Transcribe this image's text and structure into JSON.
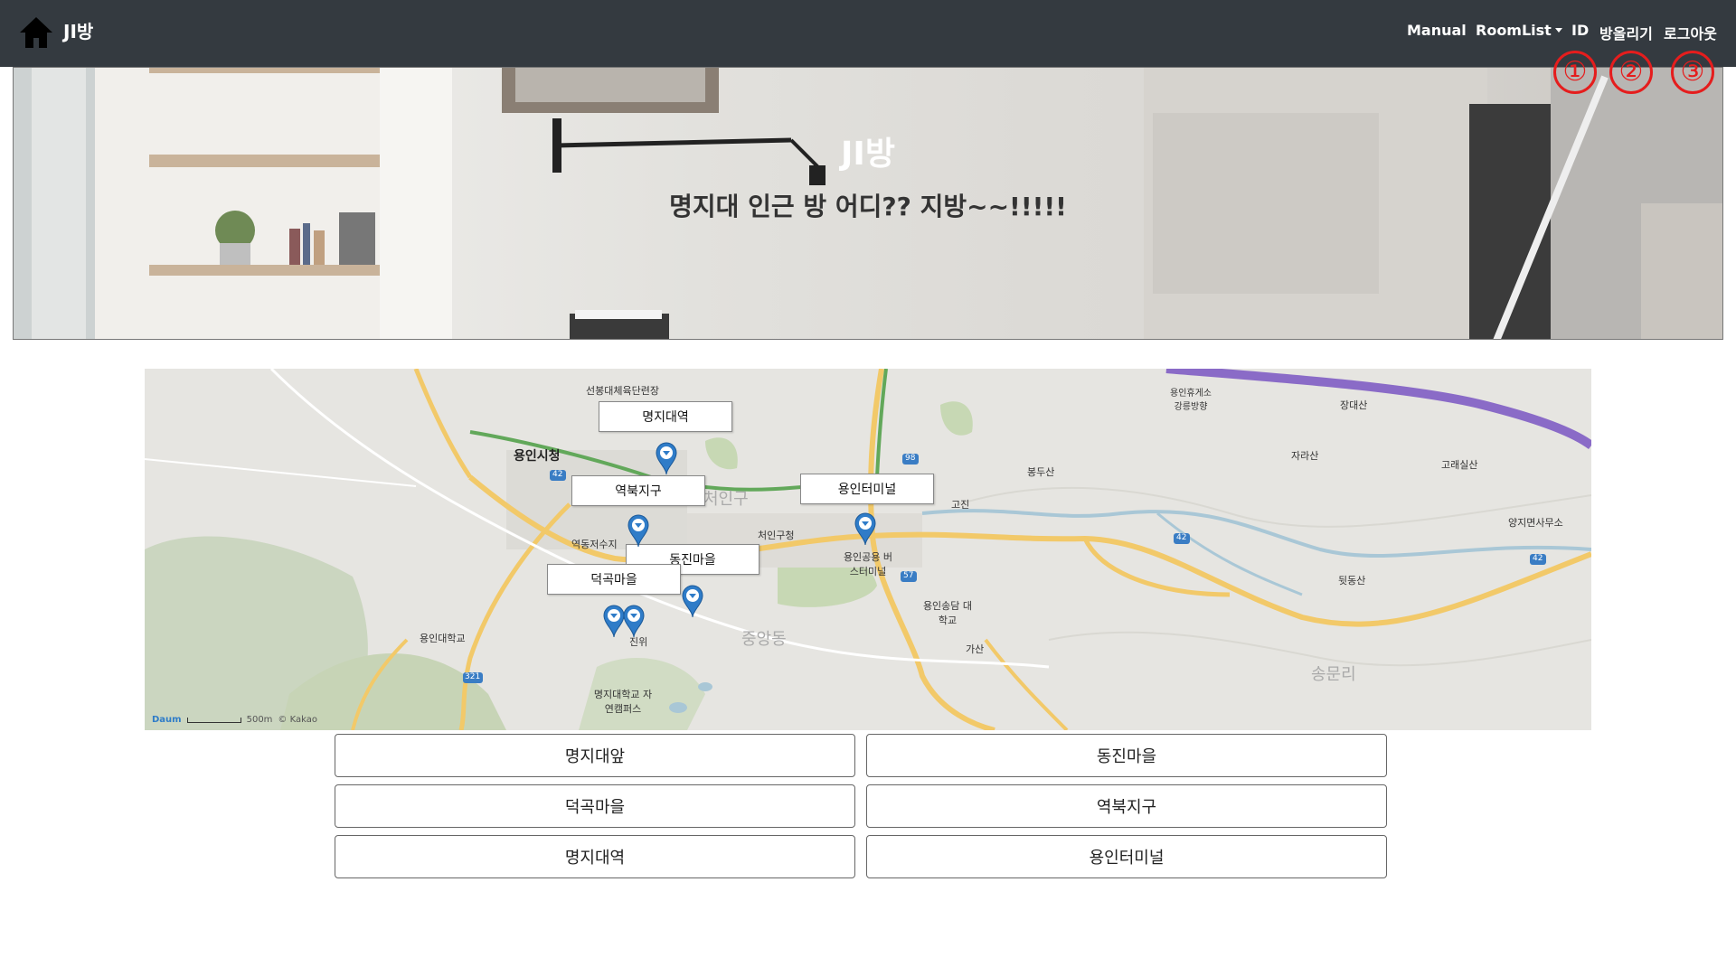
{
  "navbar": {
    "brand": "JI방",
    "home_icon": "home-icon",
    "items": {
      "manual": "Manual",
      "roomlist": "RoomList",
      "id": "ID",
      "upload": "방올리기",
      "logout": "로그아웃"
    },
    "annotations": [
      "①",
      "②",
      "③"
    ],
    "annotation_color": "#e51d1d",
    "bg_color": "#343a40"
  },
  "hero": {
    "title": "JI방",
    "subtitle": "명지대 인근 방 어디?? 지방~~!!!!!"
  },
  "map": {
    "markers": {
      "myeongji_station": "명지대역",
      "yeokbuk": "역북지구",
      "yongin_terminal": "용인터미널",
      "dongjin": "동진마을",
      "deokgok": "덕곡마을"
    },
    "place_names": {
      "sunbong_park": "선봉대체육단련장",
      "yongin_cityhall": "용인시청",
      "cheoin_gu": "처인구",
      "cheoin_office": "처인구청",
      "yeokbuk_lake": "역동저수지",
      "bus_terminal": "용인공용 버스터미널",
      "yongin_univ": "용인대학교",
      "songdam_college": "용인송담 대학교",
      "jangdaesan": "장대산",
      "jarasan": "자라산",
      "goraesilsan": "고래실산",
      "bongdusan": "봉두산",
      "twitdongsan": "뒷동산",
      "jungang_dong": "중앙동",
      "songmun_ri": "송문리",
      "myongji_campus": "명지대학교 자연캠퍼스",
      "yongin_rest": "용인휴게소 강릉방향",
      "yangji": "양지면사무소",
      "gasan": "가산",
      "jinwi": "진위",
      "gojin": "고진",
      "route42": "42",
      "route57": "57",
      "route98": "98",
      "route321": "321",
      "scale_label": "500m",
      "map_logo": "Daum",
      "map_copyright": "© Kakao"
    },
    "road_color": "#f2c969",
    "water_color": "#a9c7d6",
    "green_color": "#c7d8b4",
    "highway_color": "#8a6bc7",
    "pin_color": "#2f7cc8"
  },
  "buttons": {
    "myeongji_front": "명지대앞",
    "dongjin": "동진마을",
    "deokgok": "덕곡마을",
    "yeokbuk": "역북지구",
    "myeongji_station": "명지대역",
    "yongin_terminal": "용인터미널"
  }
}
